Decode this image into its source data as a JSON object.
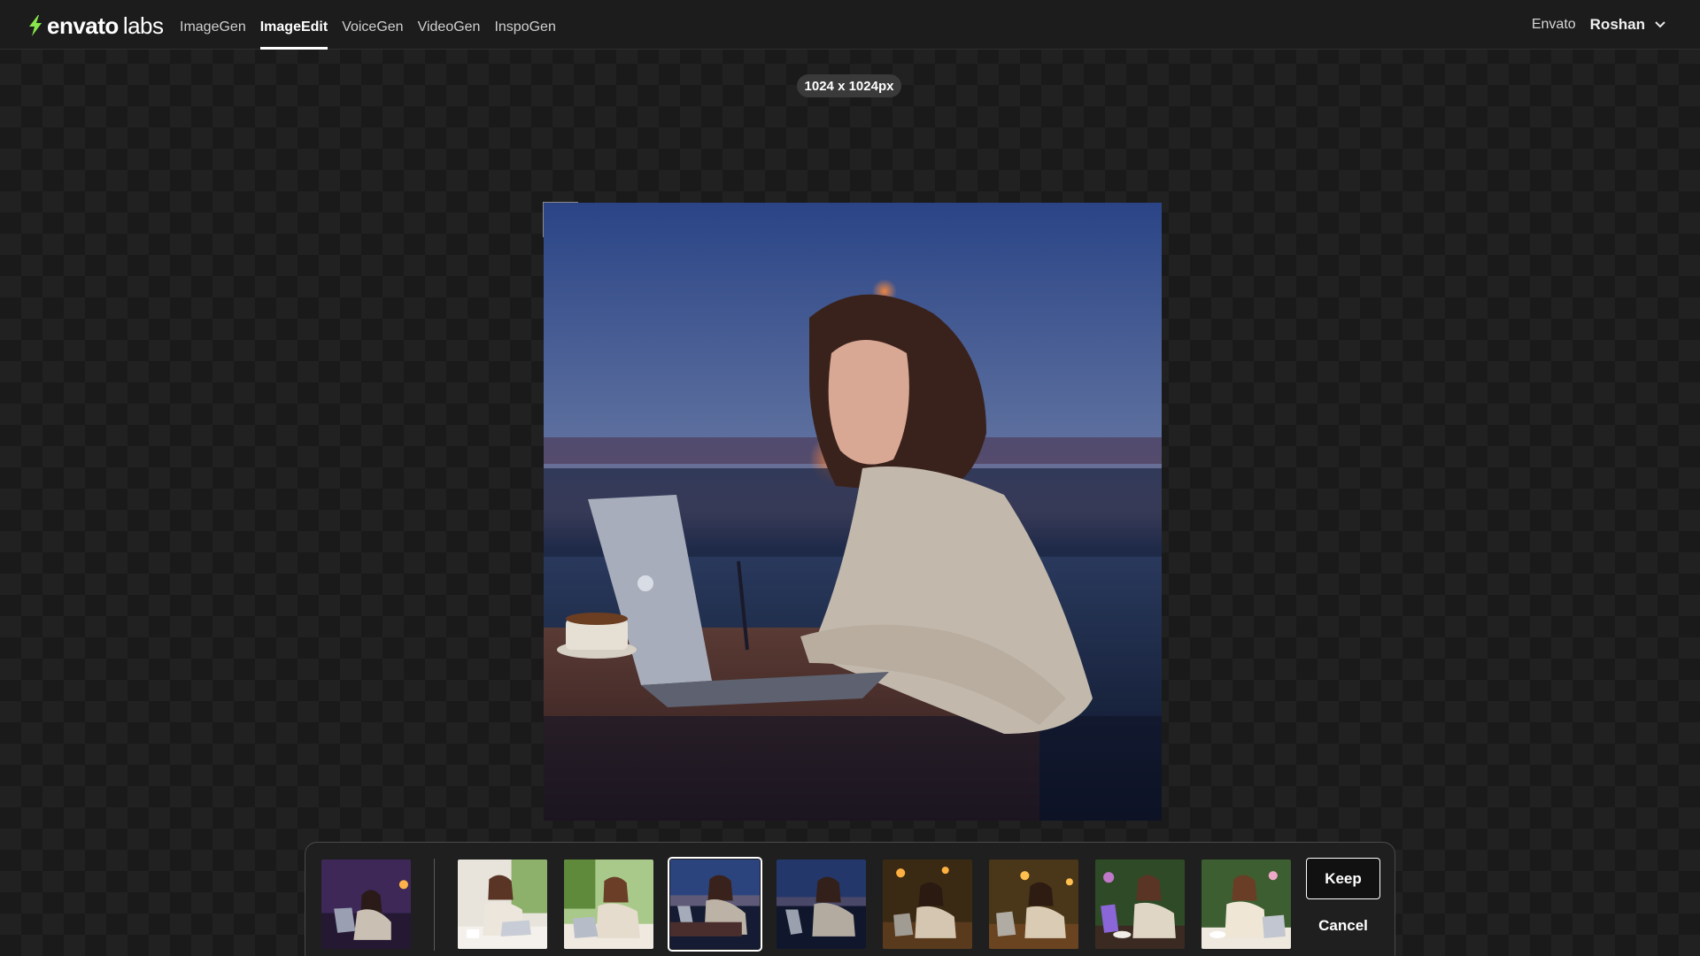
{
  "header": {
    "logo": {
      "brand": "envato",
      "sub": "labs"
    },
    "nav": [
      {
        "label": "ImageGen",
        "active": false
      },
      {
        "label": "ImageEdit",
        "active": true
      },
      {
        "label": "VoiceGen",
        "active": false
      },
      {
        "label": "VideoGen",
        "active": false
      },
      {
        "label": "InspoGen",
        "active": false
      }
    ],
    "envato_link": "Envato",
    "user_name": "Roshan"
  },
  "canvas": {
    "dimensions_label": "1024 x 1024px"
  },
  "tray": {
    "keep_label": "Keep",
    "cancel_label": "Cancel",
    "selected_index": 3
  },
  "colors": {
    "accent": "#87e64b",
    "background": "#1a1a1a",
    "text": "#ffffff"
  }
}
